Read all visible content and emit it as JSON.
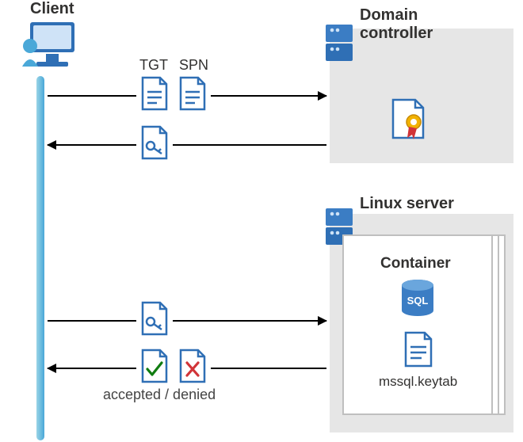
{
  "client": {
    "label": "Client"
  },
  "domain_controller": {
    "label": "Domain\ncontroller"
  },
  "linux_server": {
    "label": "Linux server"
  },
  "container": {
    "label": "Container",
    "keytab_file": "mssql.keytab",
    "db_label": "SQL"
  },
  "flow": {
    "tgt_label": "TGT",
    "spn_label": "SPN",
    "result_label": "accepted / denied"
  },
  "icons": {
    "client": "client-workstation-icon",
    "server": "server-icon",
    "doc_lines": "document-icon",
    "doc_key": "key-document-icon",
    "doc_check": "accepted-document-icon",
    "doc_cross": "denied-document-icon",
    "cert": "certificate-icon",
    "sql": "sql-database-icon"
  },
  "colors": {
    "blue_stroke": "#2f6fb5",
    "blue_fill": "#3b7dc4",
    "panel": "#e6e6e6",
    "timeline_a": "#9ad4e6",
    "timeline_b": "#4aa8d8",
    "green": "#107c10",
    "red": "#d13438",
    "gold": "#f2b200"
  }
}
